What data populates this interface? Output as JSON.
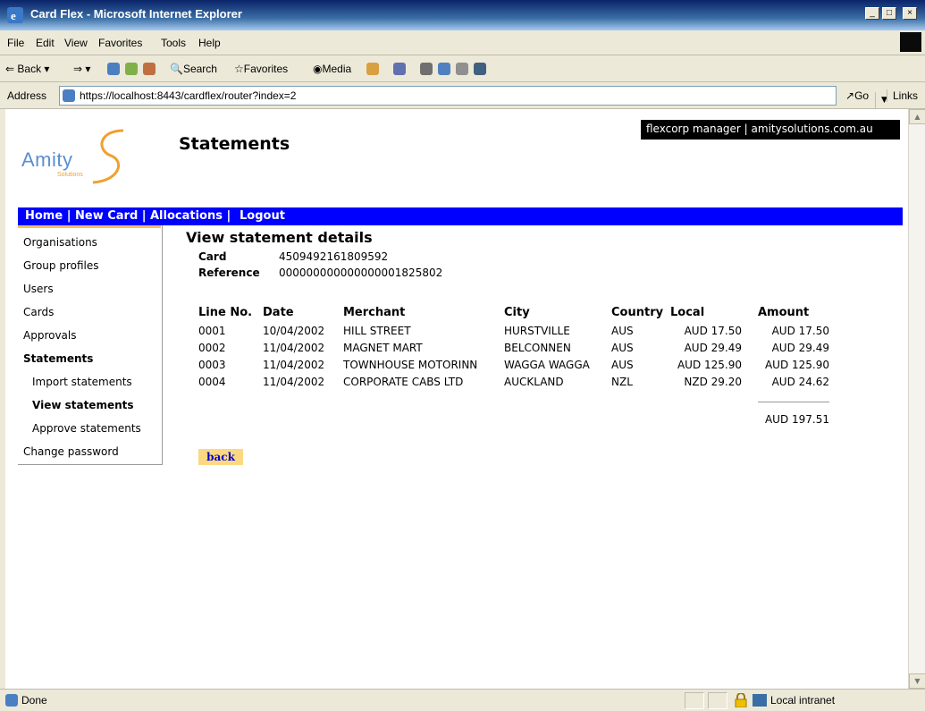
{
  "window": {
    "title": "Card Flex - Microsoft Internet Explorer"
  },
  "menubar": [
    "File",
    "Edit",
    "View",
    "Favorites",
    "Tools",
    "Help"
  ],
  "toolbar": {
    "back": "Back",
    "search": "Search",
    "favorites": "Favorites",
    "media": "Media"
  },
  "address": {
    "label": "Address",
    "url": "https://localhost:8443/cardflex/router?index=2",
    "go": "Go",
    "links": "Links"
  },
  "header": {
    "logo_text": "Amity",
    "logo_sub": "Solutions",
    "page_title": "Statements",
    "top_right": "flexcorp manager | amitysolutions.com.au"
  },
  "nav": [
    "Home |",
    "New Card |",
    "Allocations |",
    "Logout"
  ],
  "sidebar": [
    {
      "label": "Organisations"
    },
    {
      "label": "Group profiles"
    },
    {
      "label": "Users"
    },
    {
      "label": "Cards"
    },
    {
      "label": "Approvals"
    },
    {
      "label": "Statements"
    },
    {
      "label": "Import statements"
    },
    {
      "label": "View statements"
    },
    {
      "label": "Approve statements"
    },
    {
      "label": "Change password"
    }
  ],
  "details": {
    "title": "View statement details",
    "card_label": "Card",
    "card_value": "4509492161809592",
    "reference_label": "Reference",
    "reference_value": "000000000000000001825802"
  },
  "table": {
    "headers": [
      "Line No.",
      "Date",
      "Merchant",
      "City",
      "Country",
      "Local",
      "Amount"
    ],
    "rows": [
      [
        "0001",
        "10/04/2002",
        "HILL STREET",
        "HURSTVILLE",
        "AUS",
        "AUD 17.50",
        "AUD 17.50"
      ],
      [
        "0002",
        "11/04/2002",
        "MAGNET MART",
        "BELCONNEN",
        "AUS",
        "AUD 29.49",
        "AUD 29.49"
      ],
      [
        "0003",
        "11/04/2002",
        "TOWNHOUSE MOTORINN",
        "WAGGA WAGGA",
        "AUS",
        "AUD 125.90",
        "AUD 125.90"
      ],
      [
        "0004",
        "11/04/2002",
        "CORPORATE CABS LTD",
        "AUCKLAND",
        "NZL",
        "NZD 29.20",
        "AUD 24.62"
      ]
    ],
    "total": "AUD 197.51"
  },
  "back_button": "back",
  "status": {
    "text": "Done",
    "zone": "Local intranet"
  }
}
